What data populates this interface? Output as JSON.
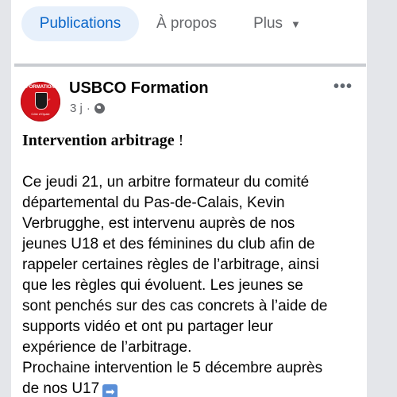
{
  "tabs": [
    {
      "label": "Publications",
      "active": true
    },
    {
      "label": "À propos",
      "active": false
    },
    {
      "label": "Plus",
      "active": false
    }
  ],
  "post": {
    "author": "USBCO Formation",
    "time": "3 j",
    "privacy_icon": "globe-icon",
    "avatar_text": {
      "top": "FORMATION",
      "side": "F",
      "bottom": "Côte d'Opale"
    },
    "title_bold": "Intervention arbitrage",
    "title_suffix": " !",
    "body_lines": [
      "Ce jeudi 21, un arbitre formateur du comité",
      "départemental du Pas-de-Calais, Kevin",
      "Verbrugghe, est intervenu auprès de nos",
      "jeunes U18 et des féminines du club afin de",
      "rappeler certaines règles de l’arbitrage, ainsi",
      "que les règles qui évoluent. Les jeunes se",
      "sont penchés sur des cas concrets à l’aide de",
      "supports vidéo et ont pu partager leur",
      "expérience de l’arbitrage.",
      "Prochaine intervention le 5 décembre auprès",
      "de nos U17"
    ],
    "end_emoji": "➡"
  },
  "colors": {
    "accent": "#0a66c9",
    "active_tab_bg": "#e7f0fb",
    "muted": "#65676b",
    "avatar_red": "#d4131b"
  }
}
